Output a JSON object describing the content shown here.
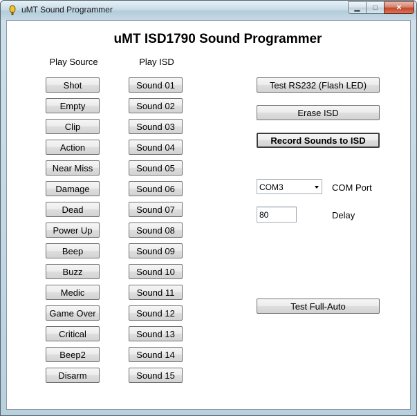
{
  "window": {
    "title": "uMT Sound Programmer",
    "minimize_glyph": "▁",
    "maximize_glyph": "□",
    "close_glyph": "✕"
  },
  "heading": "uMT ISD1790 Sound Programmer",
  "columns": {
    "source_label": "Play Source",
    "isd_label": "Play ISD"
  },
  "source_buttons": [
    "Shot",
    "Empty",
    "Clip",
    "Action",
    "Near Miss",
    "Damage",
    "Dead",
    "Power Up",
    "Beep",
    "Buzz",
    "Medic",
    "Game Over",
    "Critical",
    "Beep2",
    "Disarm"
  ],
  "isd_buttons": [
    "Sound 01",
    "Sound 02",
    "Sound 03",
    "Sound 04",
    "Sound 05",
    "Sound 06",
    "Sound 07",
    "Sound 08",
    "Sound 09",
    "Sound 10",
    "Sound 11",
    "Sound 12",
    "Sound 13",
    "Sound 14",
    "Sound 15"
  ],
  "actions": {
    "test_rs232": "Test RS232 (Flash LED)",
    "erase_isd": "Erase ISD",
    "record_sounds": "Record Sounds to ISD",
    "test_full_auto": "Test Full-Auto"
  },
  "com_port": {
    "selected": "COM3",
    "label": "COM Port"
  },
  "delay": {
    "value": "80",
    "label": "Delay"
  }
}
